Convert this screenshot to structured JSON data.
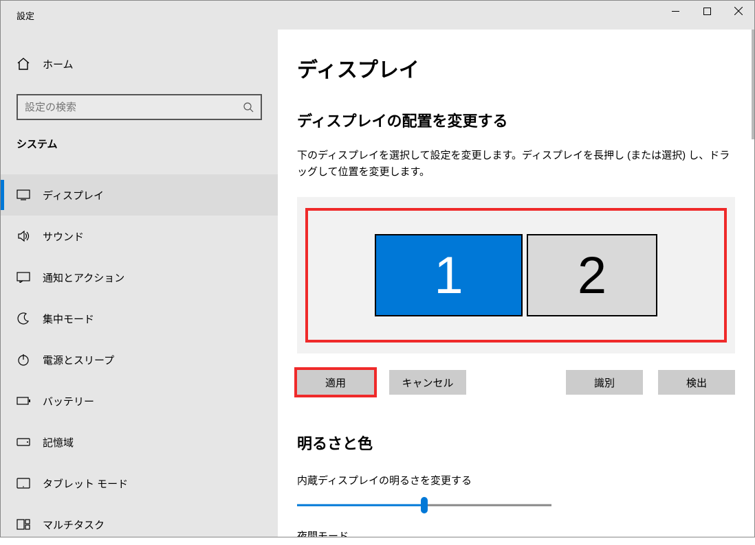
{
  "window": {
    "title": "設定"
  },
  "sidebar": {
    "home": "ホーム",
    "searchPlaceholder": "設定の検索",
    "category": "システム",
    "items": [
      {
        "label": "ディスプレイ",
        "icon": "monitor",
        "active": true
      },
      {
        "label": "サウンド",
        "icon": "sound"
      },
      {
        "label": "通知とアクション",
        "icon": "notif"
      },
      {
        "label": "集中モード",
        "icon": "focus"
      },
      {
        "label": "電源とスリープ",
        "icon": "power"
      },
      {
        "label": "バッテリー",
        "icon": "battery"
      },
      {
        "label": "記憶域",
        "icon": "storage"
      },
      {
        "label": "タブレット モード",
        "icon": "tablet"
      },
      {
        "label": "マルチタスク",
        "icon": "multitask"
      }
    ]
  },
  "main": {
    "title": "ディスプレイ",
    "arrangeTitle": "ディスプレイの配置を変更する",
    "arrangeDesc": "下のディスプレイを選択して設定を変更します。ディスプレイを長押し (または選択) し、ドラッグして位置を変更します。",
    "monitors": [
      {
        "num": "1",
        "primary": true
      },
      {
        "num": "2",
        "primary": false
      }
    ],
    "buttons": {
      "apply": "適用",
      "cancel": "キャンセル",
      "identify": "識別",
      "detect": "検出"
    },
    "brightnessSection": "明るさと色",
    "brightnessLabel": "内蔵ディスプレイの明るさを変更する",
    "nightModeLabel": "夜間モード",
    "brightnessValue": 50
  }
}
